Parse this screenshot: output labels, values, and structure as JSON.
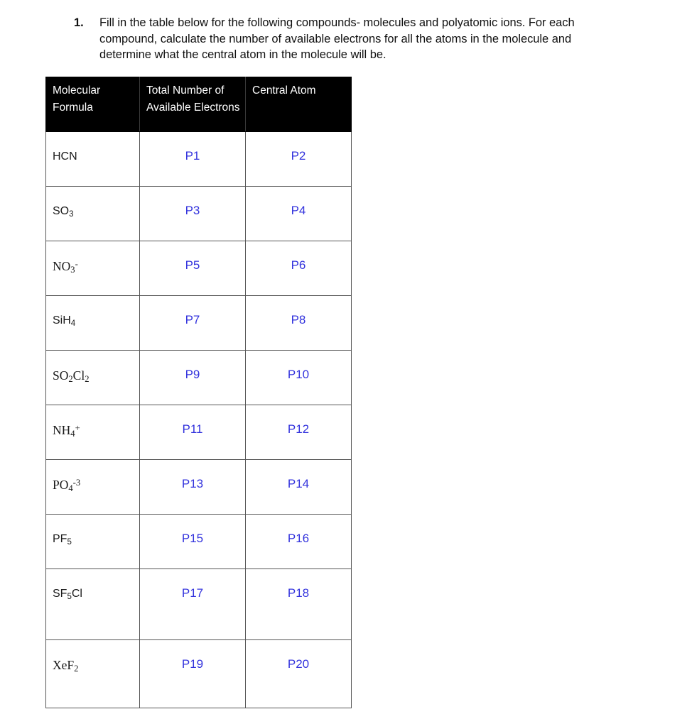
{
  "question": {
    "number": "1.",
    "lines": [
      "Fill in the table below for the following compounds- molecules and polyatomic ions.  For each",
      "compound, calculate the number of available electrons for all the atoms in the molecule and",
      "determine what the central atom in the molecule will be."
    ]
  },
  "table": {
    "headers": [
      "Molecular Formula",
      "Total Number of Available Electrons",
      "Central Atom"
    ],
    "answer_color": "#3333dd",
    "header_background": "#000000",
    "header_text_color": "#ffffff",
    "rows": [
      {
        "formula_text": "HCN",
        "formula_html": "HCN",
        "formula_style": "sans",
        "electrons": "P1",
        "central_atom": "P2"
      },
      {
        "formula_text": "SO3",
        "formula_html": "SO<sub>3</sub>",
        "formula_style": "sans",
        "electrons": "P3",
        "central_atom": "P4"
      },
      {
        "formula_text": "NO3-",
        "formula_html": "NO<sub>3</sub><sup>-</sup>",
        "formula_style": "serif",
        "electrons": "P5",
        "central_atom": "P6"
      },
      {
        "formula_text": "SiH4",
        "formula_html": "SiH<sub>4</sub>",
        "formula_style": "sans",
        "electrons": "P7",
        "central_atom": "P8"
      },
      {
        "formula_text": "SO2Cl2",
        "formula_html": "SO<sub>2</sub>Cl<sub>2</sub>",
        "formula_style": "serif",
        "electrons": "P9",
        "central_atom": "P10"
      },
      {
        "formula_text": "NH4+",
        "formula_html": "NH<sub>4</sub><sup>+</sup>",
        "formula_style": "serif",
        "electrons": "P11",
        "central_atom": "P12"
      },
      {
        "formula_text": "PO4-3",
        "formula_html": "PO<sub>4</sub><sup>-3</sup>",
        "formula_style": "serif",
        "electrons": "P13",
        "central_atom": "P14"
      },
      {
        "formula_text": "PF5",
        "formula_html": "PF<sub>5</sub>",
        "formula_style": "sans",
        "electrons": "P15",
        "central_atom": "P16"
      },
      {
        "formula_text": "SF5Cl",
        "formula_html": "SF<sub>5</sub>Cl",
        "formula_style": "sans",
        "electrons": "P17",
        "central_atom": "P18"
      },
      {
        "formula_text": "XeF2",
        "formula_html": "XeF<sub>2</sub>",
        "formula_style": "serif",
        "electrons": "P19",
        "central_atom": "P20"
      }
    ]
  }
}
